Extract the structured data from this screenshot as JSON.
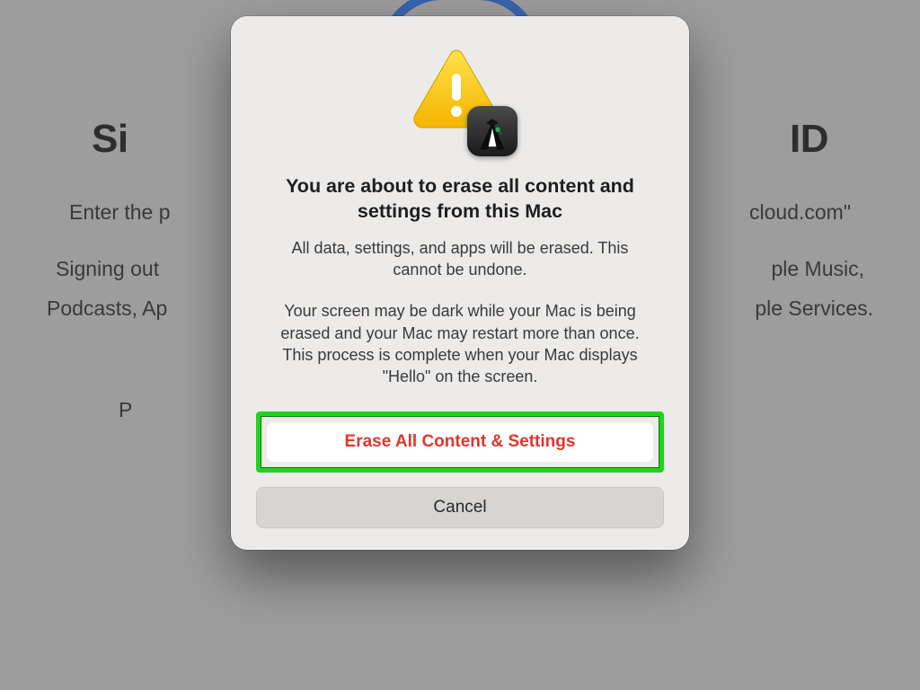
{
  "background": {
    "title_left": "Si",
    "title_right": "ID",
    "line1_left": "Enter the p",
    "line1_right": "cloud.com\"",
    "line2a_left": "Signing out",
    "line2a_right": "ple Music,",
    "line2b_left": "Podcasts, Ap",
    "line2b_right": "ple Services.",
    "line3_left": "P"
  },
  "modal": {
    "title": "You are about to erase all content and settings from this Mac",
    "body1": "All data, settings, and apps will be erased. This cannot be undone.",
    "body2": "Your screen may be dark while your Mac is being erased and your Mac may restart more than once. This process is complete when your Mac displays \"Hello\" on the screen.",
    "erase_label": "Erase All Content & Settings",
    "cancel_label": "Cancel"
  },
  "icons": {
    "warning": "warning-triangle-icon",
    "app": "erase-assistant-app-icon"
  }
}
